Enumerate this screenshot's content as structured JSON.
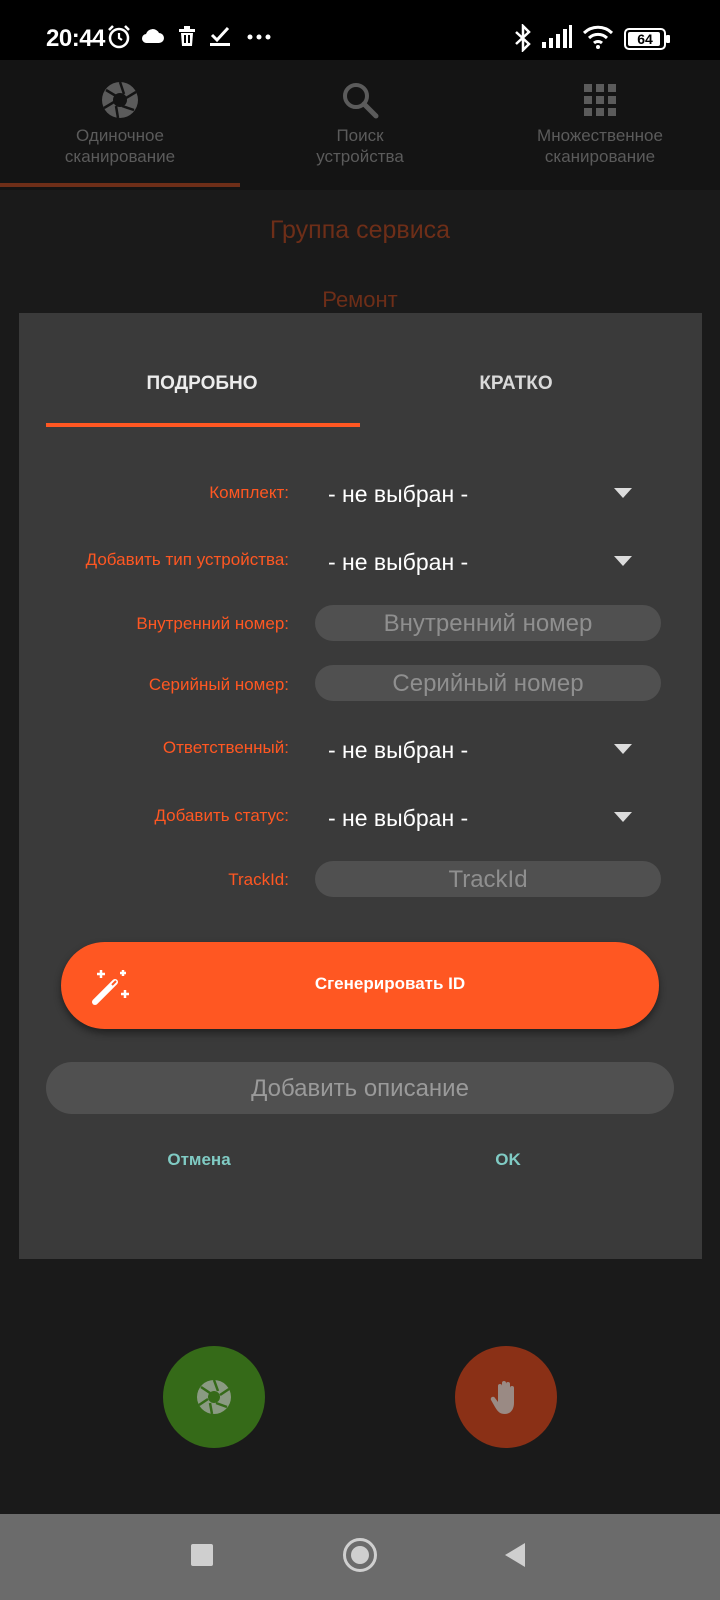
{
  "status_bar": {
    "time": "20:44",
    "battery": "64",
    "icons_left": [
      "alarm-icon",
      "cloud-icon",
      "trash-icon",
      "task-check-icon",
      "more-dots-icon"
    ],
    "icons_right": [
      "bluetooth-icon",
      "signal-icon",
      "wifi-icon",
      "battery-icon"
    ]
  },
  "app_tabs": [
    {
      "label_line1": "Одиночное",
      "label_line2": "сканирование",
      "icon": "aperture-icon",
      "active": true
    },
    {
      "label_line1": "Поиск",
      "label_line2": "устройства",
      "icon": "search-icon",
      "active": false
    },
    {
      "label_line1": "Множественное",
      "label_line2": "сканирование",
      "icon": "grid-icon",
      "active": false
    }
  ],
  "background": {
    "title": "Группа сервиса",
    "subtitle": "Ремонт"
  },
  "dialog": {
    "tabs": [
      {
        "label": "ПОДРОБНО",
        "active": true
      },
      {
        "label": "КРАТКО",
        "active": false
      }
    ],
    "fields": {
      "kit_label": "Комплект:",
      "kit_value": "- не выбран -",
      "device_type_label": "Добавить тип устройства:",
      "device_type_value": "- не выбран -",
      "internal_number_label": "Внутренний номер:",
      "internal_number_placeholder": "Внутренний номер",
      "serial_number_label": "Серийный номер:",
      "serial_number_placeholder": "Серийный номер",
      "responsible_label": "Ответственный:",
      "responsible_value": "- не выбран -",
      "status_label": "Добавить статус:",
      "status_value": "- не выбран -",
      "trackid_label": "TrackId:",
      "trackid_placeholder": "TrackId"
    },
    "generate_button": "Сгенерировать ID",
    "description_placeholder": "Добавить описание",
    "cancel_button": "Отмена",
    "ok_button": "OK"
  },
  "colors": {
    "accent": "#ff5722",
    "dialog_bg": "#3a3a3a",
    "dialog_button_text": "#80cbc4",
    "fab_green": "#356a18",
    "fab_red": "#8a3016"
  }
}
